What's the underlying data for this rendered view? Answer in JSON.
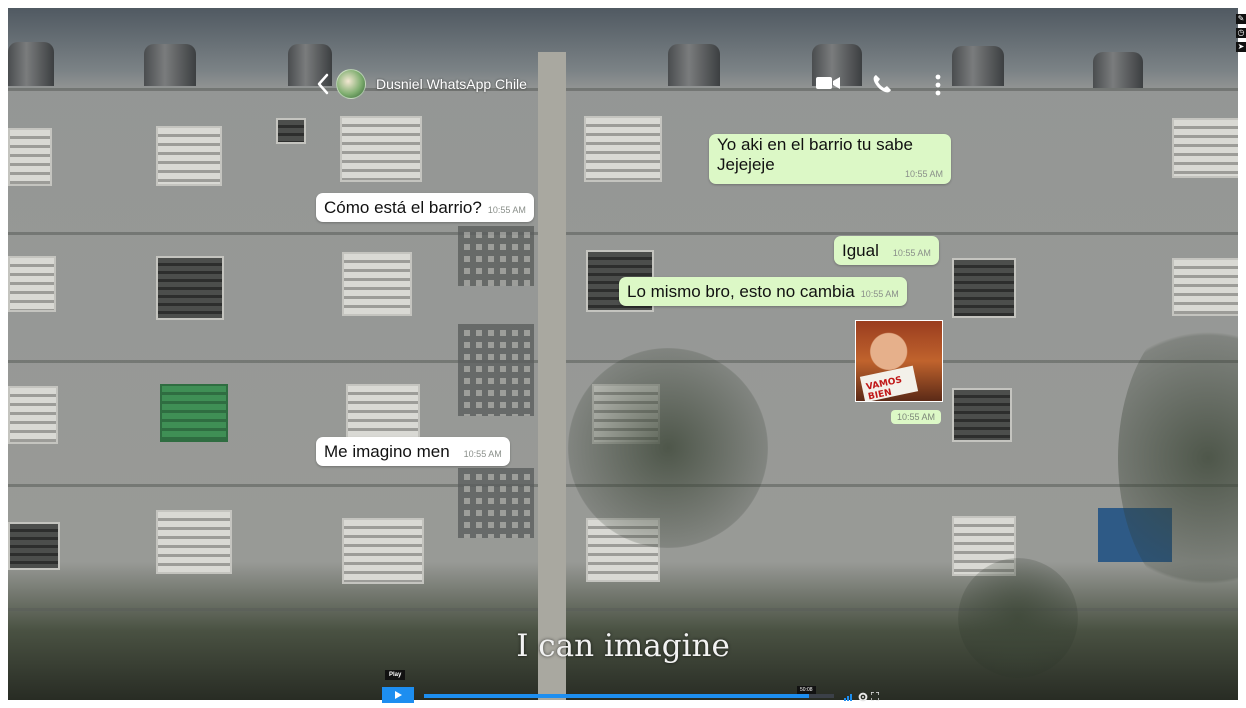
{
  "header": {
    "contact_name": "Dusniel WhatsApp Chile",
    "icons": [
      "back-arrow-icon",
      "avatar",
      "video-call-icon",
      "phone-icon",
      "more-options-icon"
    ]
  },
  "messages": [
    {
      "direction": "out",
      "text_line1": "Yo aki en el barrio tu sabe",
      "text_line2": "Jejejeje",
      "time": "10:55 AM"
    },
    {
      "direction": "in",
      "text": "Cómo está el barrio?",
      "time": "10:55 AM"
    },
    {
      "direction": "out",
      "text": "Igual",
      "time": "10:55 AM"
    },
    {
      "direction": "out",
      "text": "Lo mismo bro, esto no cambia",
      "time": "10:55 AM"
    },
    {
      "direction": "out",
      "type": "image",
      "image_caption": "VAMOS BIEN",
      "time": "10:55 AM"
    },
    {
      "direction": "in",
      "text": "Me imagino men",
      "time": "10:55 AM"
    }
  ],
  "subtitle": "I can imagine",
  "player": {
    "play_tooltip": "Play",
    "time_tooltip": "50:08",
    "progress": 0.94,
    "accent_color": "#1d8ef0"
  },
  "colors": {
    "incoming_bubble": "#ffffff",
    "outgoing_bubble": "#dcf8c6"
  }
}
